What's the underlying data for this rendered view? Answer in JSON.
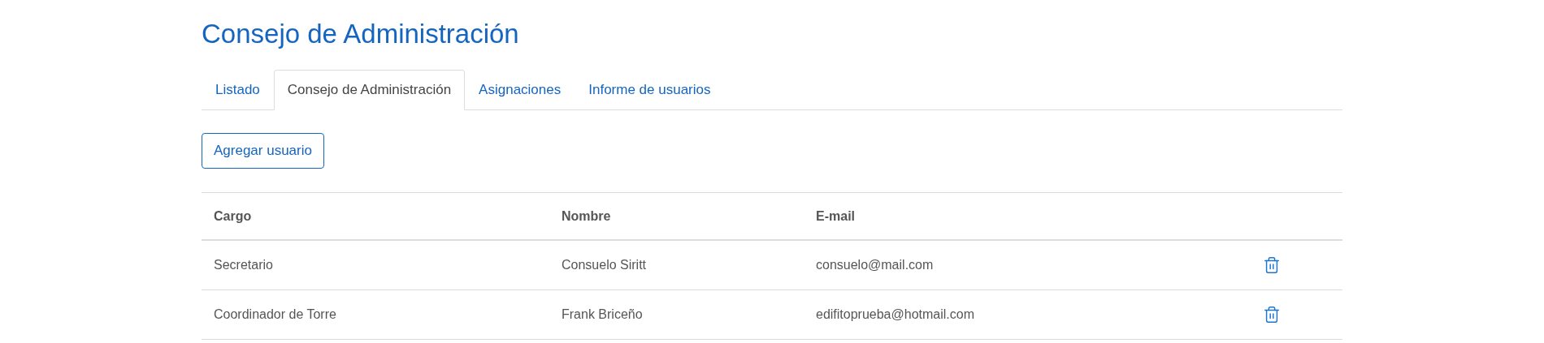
{
  "title": "Consejo de Administración",
  "tabs": [
    {
      "label": "Listado",
      "selected": false
    },
    {
      "label": "Consejo de Administración",
      "selected": true
    },
    {
      "label": "Asignaciones",
      "selected": false
    },
    {
      "label": "Informe de usuarios",
      "selected": false
    }
  ],
  "add_button": "Agregar usuario",
  "table": {
    "columns": [
      "Cargo",
      "Nombre",
      "E-mail"
    ],
    "rows": [
      {
        "cells": [
          "Secretario",
          "Consuelo Siritt",
          "consuelo@mail.com"
        ]
      },
      {
        "cells": [
          "Coordinador de Torre",
          "Frank Briceño",
          "edifitoprueba@hotmail.com"
        ]
      }
    ]
  }
}
